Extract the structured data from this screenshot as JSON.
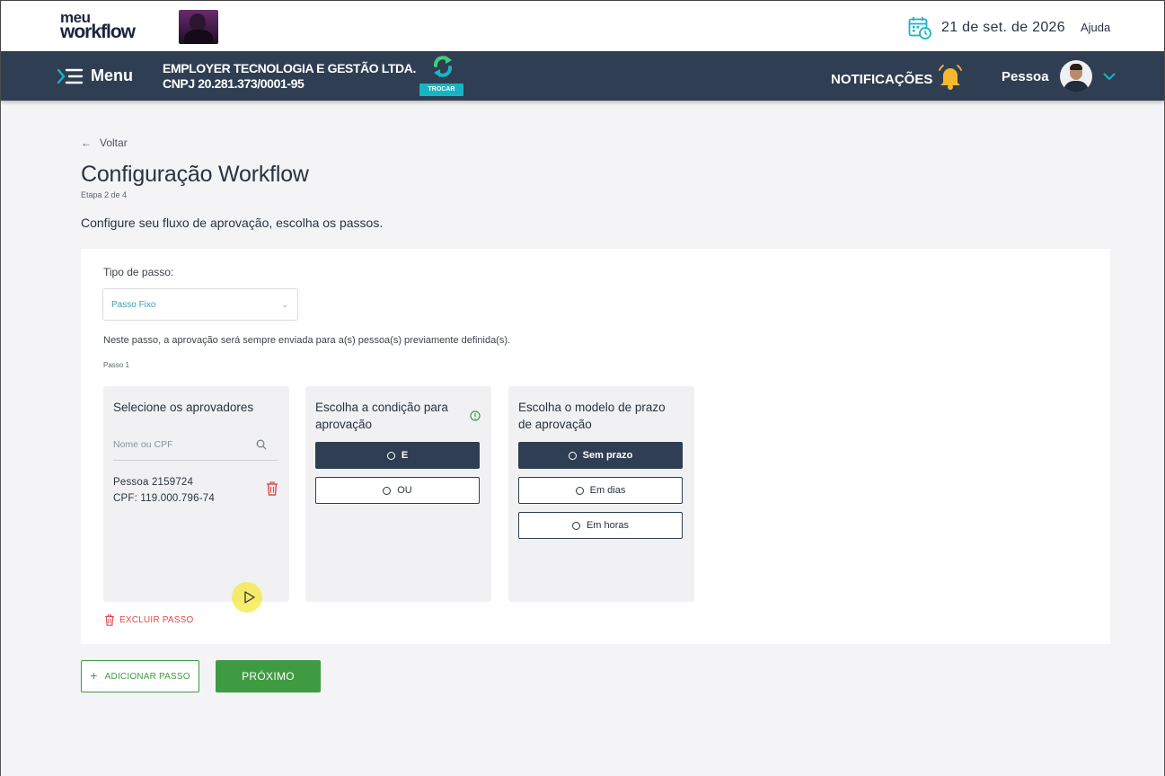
{
  "header": {
    "logo_line1": "meu",
    "logo_line2": "workflow",
    "date": "21 de set. de 2026",
    "help_label": "Ajuda"
  },
  "navbar": {
    "menu_label": "Menu",
    "company_name": "EMPLOYER TECNOLOGIA E GESTÃO LTDA.",
    "company_cnpj": "CNPJ 20.281.373/0001-95",
    "swap_label": "TROCAR",
    "notifications_label": "NOTIFICAÇÕES",
    "user_label": "Pessoa"
  },
  "page": {
    "back_label": "Voltar",
    "title": "Configuração Workflow",
    "step_indicator": "Etapa 2 de 4",
    "description": "Configure seu fluxo de aprovação, escolha os passos."
  },
  "form": {
    "step_type_label": "Tipo de passo:",
    "step_type_value": "Passo Fixo",
    "step_type_description": "Neste passo, a aprovação será sempre enviada para a(s) pessoa(s) previamente definida(s).",
    "step_number": "Passo 1",
    "approvers_panel": {
      "title": "Selecione os aprovadores",
      "search_placeholder": "Nome ou CPF",
      "approver_name": "Pessoa 2159724",
      "approver_cpf": "CPF: 119.000.796-74"
    },
    "condition_panel": {
      "title": "Escolha a condição para aprovação",
      "options": [
        {
          "label": "E",
          "selected": true
        },
        {
          "label": "OU",
          "selected": false
        }
      ]
    },
    "deadline_panel": {
      "title": "Escolha o modelo de prazo de aprovação",
      "options": [
        {
          "label": "Sem prazo",
          "selected": true
        },
        {
          "label": "Em dias",
          "selected": false
        },
        {
          "label": "Em horas",
          "selected": false
        }
      ]
    },
    "delete_step_label": "EXCLUIR PASSO"
  },
  "actions": {
    "add_step_label": "ADICIONAR PASSO",
    "next_label": "PRÓXIMO"
  },
  "colors": {
    "navbar": "#2f3e52",
    "accent_green": "#3f9b42",
    "danger_red": "#e04a4a",
    "teal": "#17b5c4"
  },
  "icons": [
    "calendar-icon",
    "menu-icon",
    "swap-icon",
    "bell-icon",
    "chevron-down-icon",
    "back-arrow-icon",
    "search-icon",
    "trash-icon",
    "help-circle-icon",
    "plus-icon"
  ]
}
